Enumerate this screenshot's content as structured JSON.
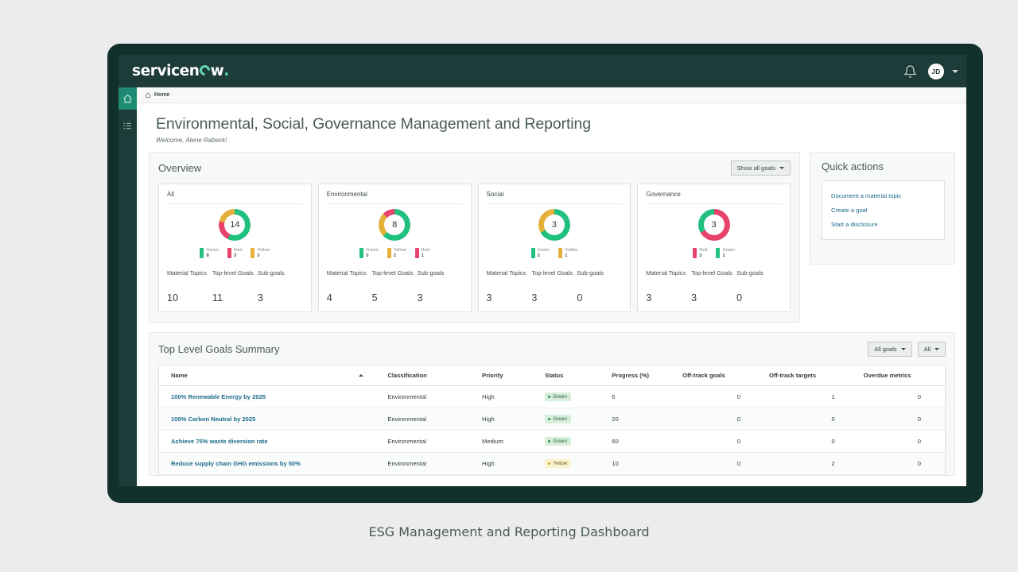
{
  "caption": "ESG Management and Reporting Dashboard",
  "topbar": {
    "logo_text": "servicen",
    "logo_suffix": "w",
    "logo_dot": ".",
    "bell_icon": "bell-icon",
    "avatar_initials": "JD"
  },
  "breadcrumb": {
    "home_label": "Home",
    "home_icon": "home-icon"
  },
  "rail": {
    "home_icon": "home-icon",
    "list_icon": "list-icon"
  },
  "page": {
    "title": "Environmental, Social, Governance Management and Reporting",
    "welcome": "Welcome, Alene Rabeck!"
  },
  "overview": {
    "title": "Overview",
    "show_all_label": "Show all goals",
    "stat_labels": {
      "material_topics": "Material Topics",
      "top_level_goals": "Top-level Goals",
      "sub_goals": "Sub-goals"
    },
    "cards": [
      {
        "title": "All",
        "total": "14",
        "legend": [
          {
            "label": "Green",
            "count": "8",
            "color": "#22c07f"
          },
          {
            "label": "Red",
            "count": "3",
            "color": "#e8446b"
          },
          {
            "label": "Yellow",
            "count": "3",
            "color": "#e3b13c"
          }
        ],
        "material_topics": "10",
        "top_level_goals": "11",
        "sub_goals": "3"
      },
      {
        "title": "Environmental",
        "total": "8",
        "legend": [
          {
            "label": "Green",
            "count": "5",
            "color": "#22c07f"
          },
          {
            "label": "Yellow",
            "count": "2",
            "color": "#e3b13c"
          },
          {
            "label": "Red",
            "count": "1",
            "color": "#e8446b"
          }
        ],
        "material_topics": "4",
        "top_level_goals": "5",
        "sub_goals": "3"
      },
      {
        "title": "Social",
        "total": "3",
        "legend": [
          {
            "label": "Green",
            "count": "2",
            "color": "#22c07f"
          },
          {
            "label": "Yellow",
            "count": "1",
            "color": "#e3b13c"
          }
        ],
        "material_topics": "3",
        "top_level_goals": "3",
        "sub_goals": "0"
      },
      {
        "title": "Governance",
        "total": "3",
        "legend": [
          {
            "label": "Red",
            "count": "2",
            "color": "#e8446b"
          },
          {
            "label": "Green",
            "count": "1",
            "color": "#22c07f"
          }
        ],
        "material_topics": "3",
        "top_level_goals": "3",
        "sub_goals": "0"
      }
    ]
  },
  "quick_actions": {
    "title": "Quick actions",
    "links": [
      "Document a material topic",
      "Create a goal",
      "Start a disclosure"
    ]
  },
  "goals_summary": {
    "title": "Top Level Goals Summary",
    "filter_goals_label": "All goals",
    "filter_all_label": "All",
    "columns": [
      "Name",
      "Classification",
      "Priority",
      "Status",
      "Progress (%)",
      "Off-track goals",
      "Off-track targets",
      "Overdue metrics"
    ],
    "rows": [
      {
        "name": "100% Renewable Energy by 2025",
        "classification": "Environmental",
        "priority": "High",
        "status": "Green",
        "progress": "6",
        "off_track_goals": "0",
        "off_track_targets": "1",
        "overdue_metrics": "0"
      },
      {
        "name": "100% Carbon Neutral by 2025",
        "classification": "Environmental",
        "priority": "High",
        "status": "Green",
        "progress": "20",
        "off_track_goals": "0",
        "off_track_targets": "0",
        "overdue_metrics": "0"
      },
      {
        "name": "Achieve 75% waste diversion rate",
        "classification": "Environmental",
        "priority": "Medium",
        "status": "Green",
        "progress": "60",
        "off_track_goals": "0",
        "off_track_targets": "0",
        "overdue_metrics": "0"
      },
      {
        "name": "Reduce supply chain GHG emissions by 50%",
        "classification": "Environmental",
        "priority": "High",
        "status": "Yellow",
        "progress": "10",
        "off_track_goals": "0",
        "off_track_targets": "2",
        "overdue_metrics": "0"
      }
    ]
  },
  "chart_data": [
    {
      "type": "pie",
      "title": "All",
      "categories": [
        "Green",
        "Red",
        "Yellow"
      ],
      "values": [
        8,
        3,
        3
      ],
      "total": 14,
      "colors": [
        "#22c07f",
        "#e8446b",
        "#e3b13c"
      ],
      "legend": "bottom"
    },
    {
      "type": "pie",
      "title": "Environmental",
      "categories": [
        "Green",
        "Yellow",
        "Red"
      ],
      "values": [
        5,
        2,
        1
      ],
      "total": 8,
      "colors": [
        "#22c07f",
        "#e3b13c",
        "#e8446b"
      ],
      "legend": "bottom"
    },
    {
      "type": "pie",
      "title": "Social",
      "categories": [
        "Green",
        "Yellow"
      ],
      "values": [
        2,
        1
      ],
      "total": 3,
      "colors": [
        "#22c07f",
        "#e3b13c"
      ],
      "legend": "bottom"
    },
    {
      "type": "pie",
      "title": "Governance",
      "categories": [
        "Red",
        "Green"
      ],
      "values": [
        2,
        1
      ],
      "total": 3,
      "colors": [
        "#e8446b",
        "#22c07f"
      ],
      "legend": "bottom"
    }
  ],
  "colors": {
    "brand_dark": "#1d3b38",
    "brand_green": "#1f8a73",
    "link": "#1b6b8c",
    "status_green": "#22c07f",
    "status_yellow": "#e3b13c",
    "status_red": "#e8446b"
  }
}
